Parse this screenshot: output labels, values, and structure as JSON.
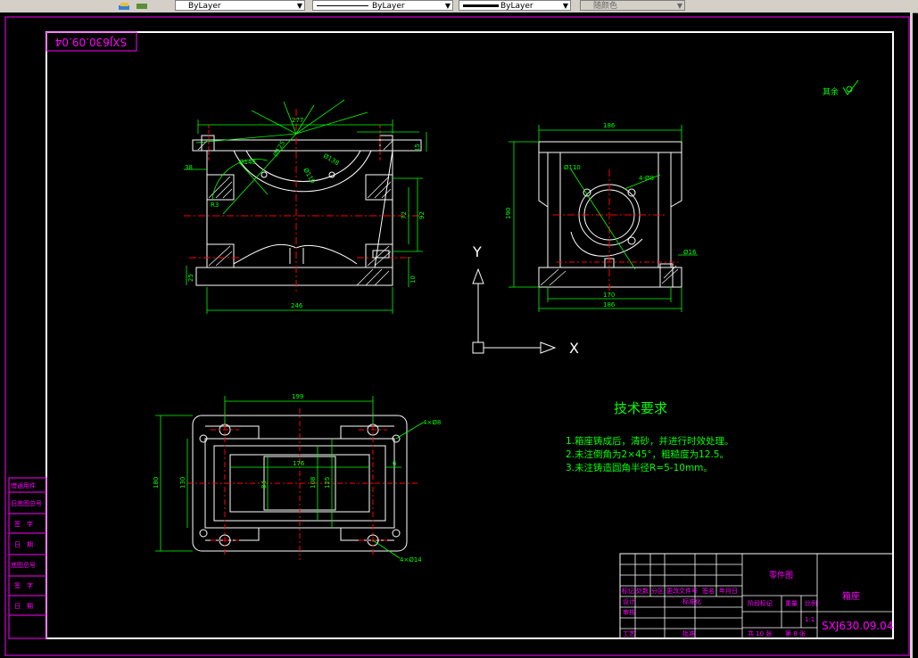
{
  "toolbar": {
    "layer_value": "ByLayer",
    "linetype_value": "ByLayer",
    "lineweight_value": "ByLayer",
    "color_value": "随颜色"
  },
  "drawing": {
    "corner_stamp": "SXJ630.09.04",
    "roughness_note": "其余",
    "ucs_x": "X",
    "ucs_y": "Y",
    "tech_title": "技术要求",
    "tech_notes": [
      "1.箱座铸成后，清砂，并进行时效处理。",
      "2.未注倒角为2×45°，粗糙度为12.5。",
      "3.未注铸造圆角半径R=5-10mm。"
    ],
    "front_dims": {
      "top_width": "277",
      "base_width": "246",
      "dim_15": "15",
      "dim_92": "92",
      "dim_72": "72",
      "dim_38": "38",
      "dim_25": "25",
      "dim_10": "10",
      "dim_r1": "Ø125",
      "dim_r2": "Ø110",
      "dim_r3": "Ø148",
      "dim_r4": "Ø138",
      "dim_r5": "R3"
    },
    "side_dims": {
      "top_width": "186",
      "height": "190",
      "inner_width": "170",
      "base_width": "186",
      "bore": "Ø110",
      "hole": "4-Ø8",
      "pin": "Ø16"
    },
    "plan_dims": {
      "top": "199",
      "height": "180",
      "inner_h1": "130",
      "inner_width": "176",
      "mid_h": "84",
      "right_h1": "108",
      "right_h2": "125",
      "small": "6",
      "hole_top": "4×Ø8",
      "hole_bot": "4×Ø14"
    },
    "left_strip": [
      "借通用件",
      "旧底图总号",
      "签　字",
      "日　期",
      "底图总号",
      "签　字",
      "日　期"
    ],
    "title_block": {
      "part_label": "零件图",
      "part_name": "箱座",
      "drawing_no": "SXJ630.09.04",
      "headers": [
        "标记",
        "处数",
        "分区",
        "更改文件号",
        "签名",
        "年月日"
      ],
      "roles": [
        "设计",
        "审核",
        "工艺"
      ],
      "standard": "标准化",
      "approve": "批准",
      "stage": "阶段标记",
      "weight": "重量",
      "scale": "比例",
      "scale_value": "1:1",
      "sheets": "共 10 张",
      "sheet": "第 8 张"
    },
    "colors": {
      "frame_white": "#ffffff",
      "magenta": "#ff00ff",
      "green": "#00ff00",
      "red": "#ff0000"
    }
  }
}
